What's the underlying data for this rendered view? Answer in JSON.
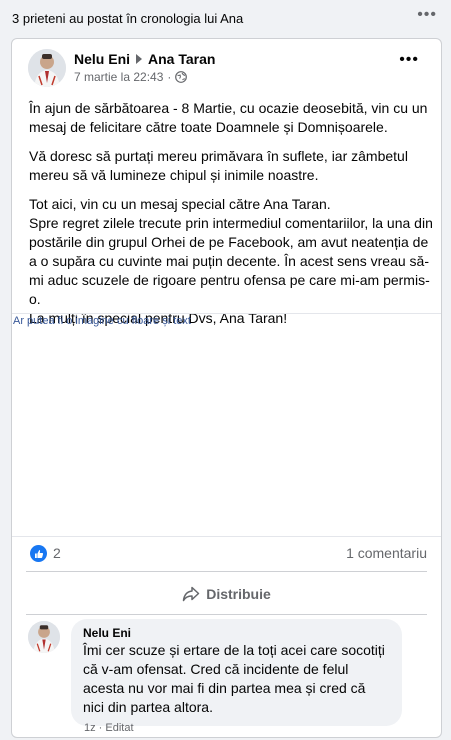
{
  "top_bar": {
    "notice": "3 prieteni au postat în cronologia lui Ana",
    "more_icon": "more-horizontal-icon"
  },
  "post": {
    "author": "Nelu Eni",
    "target": "Ana Taran",
    "timestamp": "7 martie la 22:43",
    "separator": "·",
    "privacy_icon": "globe-icon",
    "paragraphs": [
      "În ajun de sărbătoarea - 8 Martie, cu ocazie deosebită, vin cu un mesaj de felicitare către toate Doamnele și Domnișoarele.",
      " Vă doresc să purtați mereu primăvara în suflete, iar zâmbetul mereu să vă lumineze chipul și inimile noastre.",
      " Tot aici, vin cu un mesaj special către Ana Taran.\n Spre regret zilele trecute prin intermediul comentariilor, la una din postările din grupul Orhei de pe Facebook, am avut neatenția de a o supăra cu cuvinte mai puțin decente. În acest sens vreau să-mi aduc scuzele de rigoare pentru ofensa pe care mi-am permis-o.\nLa mulți în special pentru Dvs, Ana Taran!"
    ],
    "image_alt": "Ar putea fi o imagine cu floare și text",
    "likes": "2",
    "comments": "1 comentariu",
    "share_label": "Distribuie"
  },
  "comment": {
    "author": "Nelu Eni",
    "text": "Îmi cer scuze și ertare de la toți acei care socotiți că v-am ofensat. Cred că incidente de felul acesta nu vor mai fi din partea mea și cred că nici din partea altora.",
    "meta": "1z · Editat"
  },
  "colors": {
    "accent": "#1877f2",
    "secondary_text": "#65676b",
    "link": "#385898"
  }
}
